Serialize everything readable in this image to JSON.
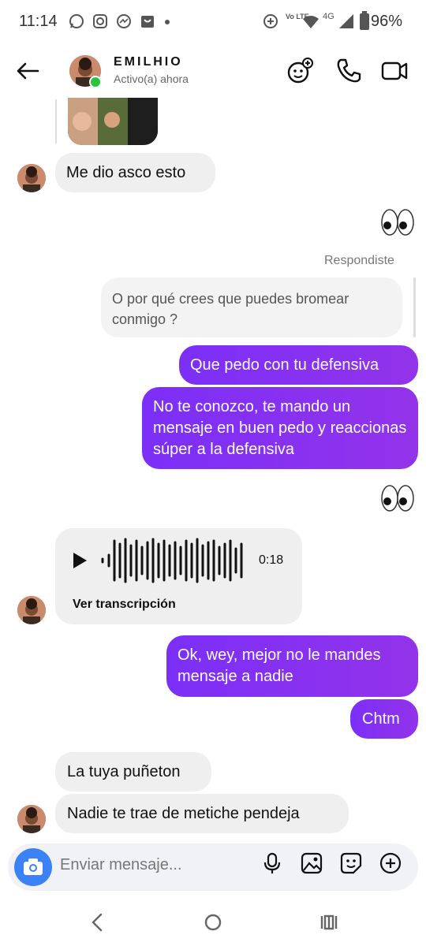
{
  "status_bar": {
    "time": "11:14",
    "battery": "96%",
    "network": "4G",
    "volte": "Vo LTE"
  },
  "header": {
    "contact_name": "EMILHIO",
    "contact_status": "Activo(a) ahora"
  },
  "messages": {
    "m1_in": "Me dio asco esto",
    "reply_label": "Respondiste",
    "quoted_text": "O por qué crees que puedes bromear conmigo ?",
    "m2_out": "Que pedo con tu defensiva",
    "m3_out": "No te conozco, te mando un mensaje en buen pedo y reaccionas súper a la defensiva",
    "voice_duration": "0:18",
    "voice_transcription": "Ver transcripción",
    "m4_out": "Ok, wey, mejor no le mandes mensaje a nadie",
    "m5_out": "Chtm",
    "m6_in": "La tuya puñeton",
    "m7_in": "Nadie te trae de metiche pendeja"
  },
  "composer": {
    "placeholder": "Enviar mensaje..."
  },
  "colors": {
    "outgoing_bubble": "#8b2ff0",
    "incoming_bubble": "#efefef",
    "online_dot": "#27c53b",
    "camera_button": "#3b82f6"
  }
}
